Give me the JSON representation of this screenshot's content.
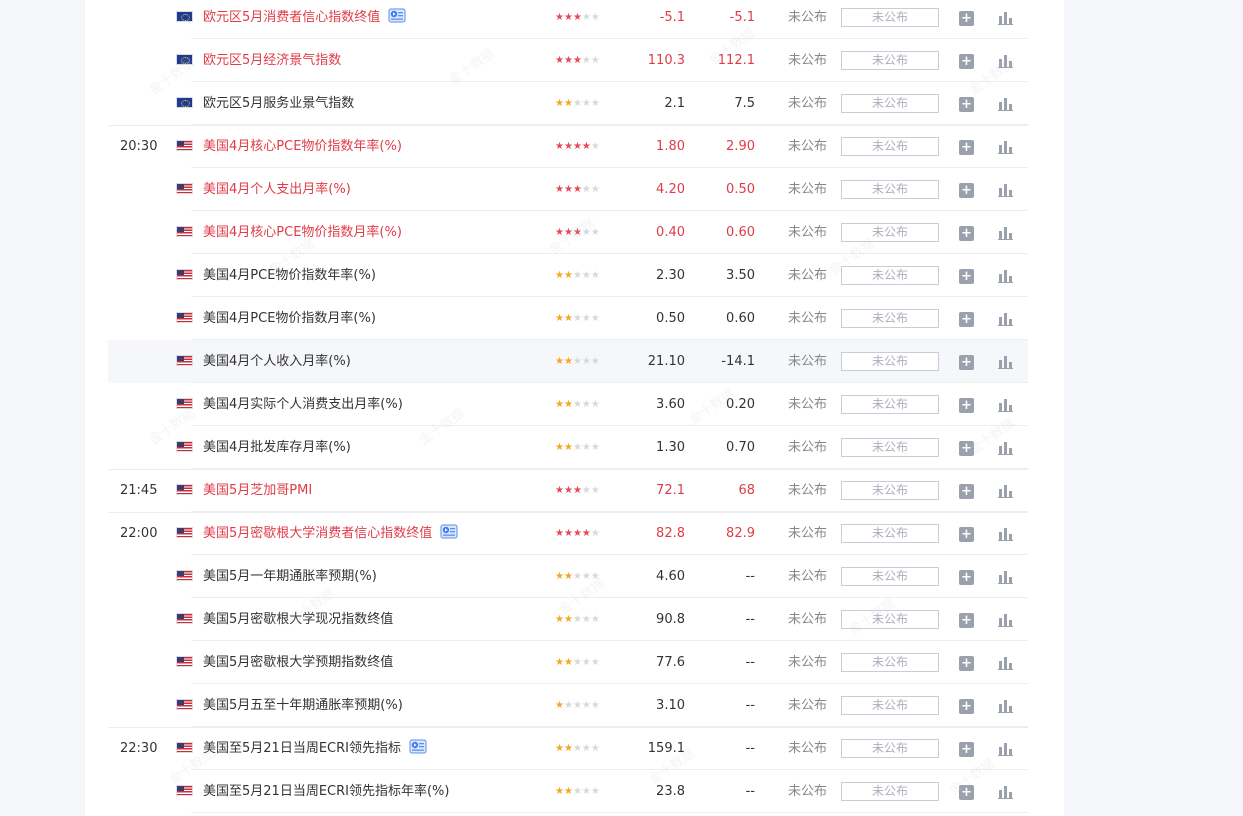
{
  "calendar": {
    "status_text": "未公布",
    "actual_placeholder": "未公布",
    "watermark": "金十数据",
    "rows": [
      {
        "time": "",
        "flag": "eu",
        "name": "欧元区5月消费者信心指数终值",
        "highlight_name": true,
        "stars": 3,
        "star_color": "red",
        "previous": "-5.1",
        "forecast": "-5.1",
        "value_red": true,
        "video": true,
        "hover": false
      },
      {
        "time": "",
        "flag": "eu",
        "name": "欧元区5月经济景气指数",
        "highlight_name": true,
        "stars": 3,
        "star_color": "red",
        "previous": "110.3",
        "forecast": "112.1",
        "value_red": true,
        "video": false,
        "hover": false
      },
      {
        "time": "",
        "flag": "eu",
        "name": "欧元区5月服务业景气指数",
        "highlight_name": false,
        "stars": 2,
        "star_color": "orange",
        "previous": "2.1",
        "forecast": "7.5",
        "value_red": false,
        "video": false,
        "hover": false
      },
      {
        "time": "20:30",
        "flag": "us",
        "name": "美国4月核心PCE物价指数年率(%)",
        "highlight_name": true,
        "stars": 4,
        "star_color": "red",
        "previous": "1.80",
        "forecast": "2.90",
        "value_red": true,
        "video": false,
        "hover": false
      },
      {
        "time": "",
        "flag": "us",
        "name": "美国4月个人支出月率(%)",
        "highlight_name": true,
        "stars": 3,
        "star_color": "red",
        "previous": "4.20",
        "forecast": "0.50",
        "value_red": true,
        "video": false,
        "hover": false
      },
      {
        "time": "",
        "flag": "us",
        "name": "美国4月核心PCE物价指数月率(%)",
        "highlight_name": true,
        "stars": 3,
        "star_color": "red",
        "previous": "0.40",
        "forecast": "0.60",
        "value_red": true,
        "video": false,
        "hover": false
      },
      {
        "time": "",
        "flag": "us",
        "name": "美国4月PCE物价指数年率(%)",
        "highlight_name": false,
        "stars": 2,
        "star_color": "orange",
        "previous": "2.30",
        "forecast": "3.50",
        "value_red": false,
        "video": false,
        "hover": false
      },
      {
        "time": "",
        "flag": "us",
        "name": "美国4月PCE物价指数月率(%)",
        "highlight_name": false,
        "stars": 2,
        "star_color": "orange",
        "previous": "0.50",
        "forecast": "0.60",
        "value_red": false,
        "video": false,
        "hover": false
      },
      {
        "time": "",
        "flag": "us",
        "name": "美国4月个人收入月率(%)",
        "highlight_name": false,
        "stars": 2,
        "star_color": "orange",
        "previous": "21.10",
        "forecast": "-14.1",
        "value_red": false,
        "video": false,
        "hover": true
      },
      {
        "time": "",
        "flag": "us",
        "name": "美国4月实际个人消费支出月率(%)",
        "highlight_name": false,
        "stars": 2,
        "star_color": "orange",
        "previous": "3.60",
        "forecast": "0.20",
        "value_red": false,
        "video": false,
        "hover": false
      },
      {
        "time": "",
        "flag": "us",
        "name": "美国4月批发库存月率(%)",
        "highlight_name": false,
        "stars": 2,
        "star_color": "orange",
        "previous": "1.30",
        "forecast": "0.70",
        "value_red": false,
        "video": false,
        "hover": false
      },
      {
        "time": "21:45",
        "flag": "us",
        "name": "美国5月芝加哥PMI",
        "highlight_name": true,
        "stars": 3,
        "star_color": "red",
        "previous": "72.1",
        "forecast": "68",
        "value_red": true,
        "video": false,
        "hover": false
      },
      {
        "time": "22:00",
        "flag": "us",
        "name": "美国5月密歇根大学消费者信心指数终值",
        "highlight_name": true,
        "stars": 4,
        "star_color": "red",
        "previous": "82.8",
        "forecast": "82.9",
        "value_red": true,
        "video": true,
        "hover": false
      },
      {
        "time": "",
        "flag": "us",
        "name": "美国5月一年期通胀率预期(%)",
        "highlight_name": false,
        "stars": 2,
        "star_color": "orange",
        "previous": "4.60",
        "forecast": "--",
        "value_red": false,
        "video": false,
        "hover": false
      },
      {
        "time": "",
        "flag": "us",
        "name": "美国5月密歇根大学现况指数终值",
        "highlight_name": false,
        "stars": 2,
        "star_color": "orange",
        "previous": "90.8",
        "forecast": "--",
        "value_red": false,
        "video": false,
        "hover": false
      },
      {
        "time": "",
        "flag": "us",
        "name": "美国5月密歇根大学预期指数终值",
        "highlight_name": false,
        "stars": 2,
        "star_color": "orange",
        "previous": "77.6",
        "forecast": "--",
        "value_red": false,
        "video": false,
        "hover": false
      },
      {
        "time": "",
        "flag": "us",
        "name": "美国5月五至十年期通胀率预期(%)",
        "highlight_name": false,
        "stars": 1,
        "star_color": "orange",
        "previous": "3.10",
        "forecast": "--",
        "value_red": false,
        "video": false,
        "hover": false
      },
      {
        "time": "22:30",
        "flag": "us",
        "name": "美国至5月21日当周ECRI领先指标",
        "highlight_name": false,
        "stars": 2,
        "star_color": "orange",
        "previous": "159.1",
        "forecast": "--",
        "value_red": false,
        "video": true,
        "hover": false
      },
      {
        "time": "",
        "flag": "us",
        "name": "美国至5月21日当周ECRI领先指标年率(%)",
        "highlight_name": false,
        "stars": 2,
        "star_color": "orange",
        "previous": "23.8",
        "forecast": "--",
        "value_red": false,
        "video": false,
        "hover": false
      }
    ]
  },
  "colors": {
    "red": "#e03c48",
    "orange": "#f5a623",
    "muted": "#888888"
  }
}
